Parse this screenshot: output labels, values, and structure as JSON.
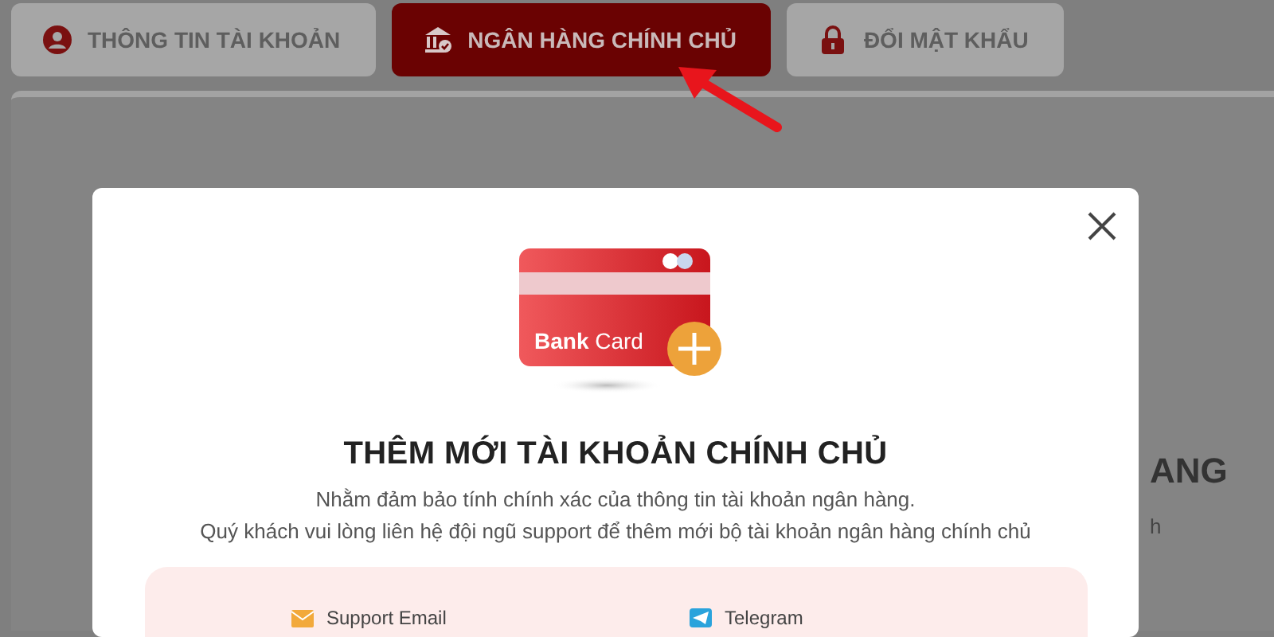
{
  "tabs": [
    {
      "label": "THÔNG TIN TÀI KHOẢN",
      "kind": "user",
      "selected": false
    },
    {
      "label": "NGÂN HÀNG CHÍNH CHỦ",
      "kind": "bank",
      "selected": true
    },
    {
      "label": "ĐỔI MẬT KHẨU",
      "kind": "lock",
      "selected": false
    }
  ],
  "background_page": {
    "heading": "ANG",
    "text": "h"
  },
  "modal": {
    "card_label_bold": "Bank",
    "card_label": "Card",
    "title": "THÊM MỚI TÀI KHOẢN CHÍNH CHỦ",
    "description": [
      "Nhằm đảm bảo tính chính xác của thông tin tài khoản ngân hàng.",
      "Quý khách vui lòng liên hệ đội ngũ support để thêm mới bộ tài khoản ngân hàng chính chủ"
    ],
    "contacts": [
      {
        "kind": "email",
        "label": "Support Email"
      },
      {
        "kind": "telegram",
        "label": "Telegram"
      }
    ]
  }
}
